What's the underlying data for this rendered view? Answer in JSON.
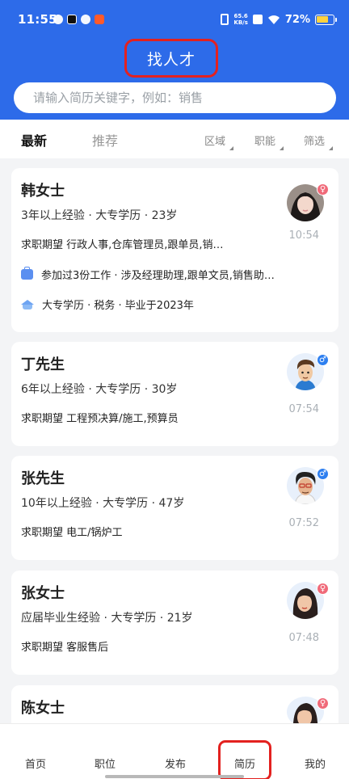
{
  "status_bar": {
    "time": "11:55",
    "net_speed_top": "65.6",
    "net_speed_bottom": "KB/s",
    "battery_text": "72%",
    "battery_level": 0.72
  },
  "header": {
    "title": "找人才",
    "search_placeholder": "请输入简历关键字，例如：销售"
  },
  "tabs": {
    "latest": "最新",
    "recommend": "推荐",
    "filters": [
      "区域",
      "职能",
      "筛选"
    ]
  },
  "candidates": [
    {
      "name": "韩女士",
      "meta": "3年以上经验 · 大专学历 · 23岁",
      "expect": "求职期望 行政人事,仓库管理员,跟单员,销…",
      "work": "参加过3份工作 · 涉及经理助理,跟单文员,销售助…",
      "edu": "大专学历 · 税务 · 毕业于2023年",
      "time": "10:54",
      "gender": "female",
      "avatar": "photo-avatar"
    },
    {
      "name": "丁先生",
      "meta": "6年以上经验 · 大专学历 · 30岁",
      "expect": "求职期望 工程预决算/施工,预算员",
      "time": "07:54",
      "gender": "male",
      "avatar": "cartoon-man-avatar"
    },
    {
      "name": "张先生",
      "meta": "10年以上经验 · 大专学历 · 47岁",
      "expect": "求职期望 电工/锅炉工",
      "time": "07:52",
      "gender": "male",
      "avatar": "cartoon-man-glasses-avatar"
    },
    {
      "name": "张女士",
      "meta": "应届毕业生经验 · 大专学历 · 21岁",
      "expect": "求职期望 客服售后",
      "time": "07:48",
      "gender": "female",
      "avatar": "cartoon-woman-avatar"
    },
    {
      "name": "陈女士",
      "gender": "female",
      "avatar": "cartoon-woman-avatar"
    }
  ],
  "gender_symbols": {
    "male": "♂",
    "female": "♀"
  },
  "bottom_nav": [
    "首页",
    "职位",
    "发布",
    "简历",
    "我的"
  ],
  "colors": {
    "brand_blue": "#2d6be9",
    "highlight_red": "#e3211f",
    "female_badge": "#f06a79",
    "male_badge": "#2d7ff0"
  }
}
